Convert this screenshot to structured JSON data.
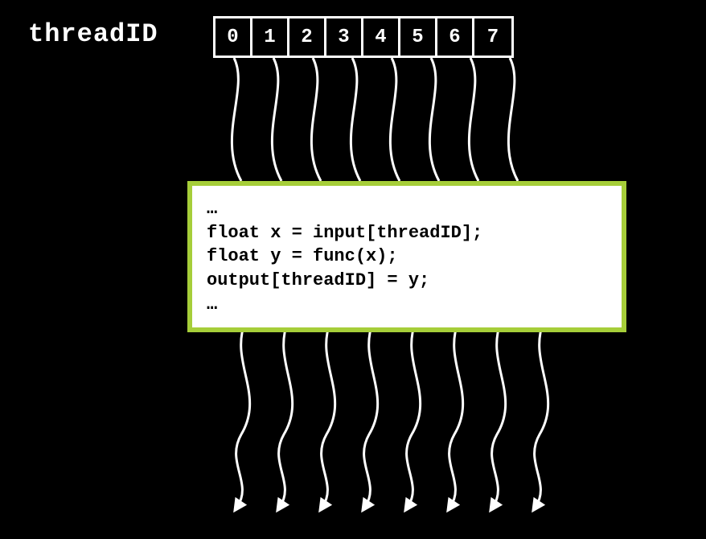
{
  "title": "threadID",
  "threads": [
    "0",
    "1",
    "2",
    "3",
    "4",
    "5",
    "6",
    "7"
  ],
  "code": {
    "l0": "…",
    "l1": "float x = input[threadID];",
    "l2": "float y = func(x);",
    "l3": "output[threadID] = y;",
    "l4": "…"
  },
  "colors": {
    "accent": "#a6ce39",
    "bg": "#000000",
    "fg": "#ffffff"
  }
}
